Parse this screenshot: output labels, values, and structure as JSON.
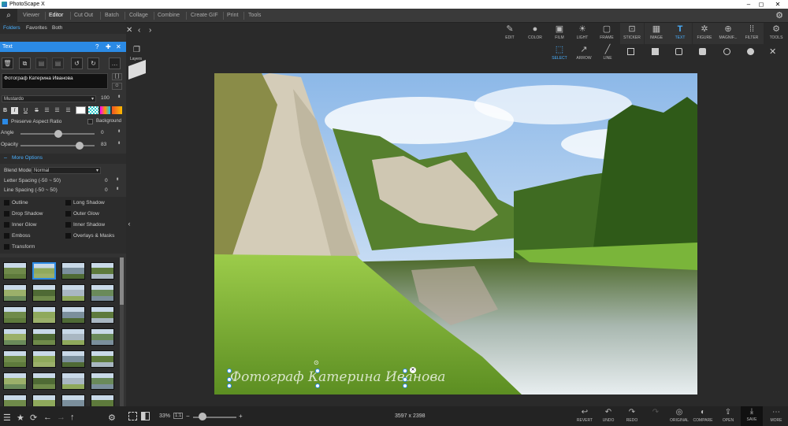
{
  "app": {
    "title": "PhotoScape X"
  },
  "menu": [
    "Viewer",
    "Editor",
    "Cut Out",
    "Batch",
    "Collage",
    "Combine",
    "Create GIF",
    "Print",
    "Tools"
  ],
  "left_tabs": [
    "Folders",
    "Favorites",
    "Both"
  ],
  "panel": {
    "title": "Text",
    "layers_label": "Layers",
    "text_value": "Фотограф Катерина Иванова",
    "font": "Mustardo",
    "font_size": "100",
    "preserve_label": "Preserve Aspect Ratio",
    "background_label": "Background",
    "angle_label": "Angle",
    "angle_value": "0",
    "opacity_label": "Opacity",
    "opacity_value": "83",
    "more_options": "More Options",
    "blend_label": "Blend Mode",
    "blend_value": "Normal",
    "letter_label": "Letter Spacing (-50 ~ 50)",
    "letter_value": "0",
    "line_label": "Line Spacing (-50 ~ 50)",
    "line_value": "0",
    "effects": {
      "outline": "Outline",
      "long_shadow": "Long Shadow",
      "drop_shadow": "Drop Shadow",
      "outer_glow": "Outer Glow",
      "inner_glow": "Inner Glow",
      "inner_shadow": "Inner Shadow",
      "emboss": "Emboss",
      "overlays": "Overlays & Masks",
      "transform": "Transform"
    },
    "format_buttons": [
      "B",
      "I",
      "U",
      "S"
    ]
  },
  "tools": {
    "top": [
      "EDIT",
      "COLOR",
      "FILM",
      "LIGHT",
      "FRAME",
      "STICKER",
      "IMAGE",
      "TEXT",
      "FIGURE",
      "MAGNIF...",
      "FILTER",
      "TOOLS"
    ],
    "sub": [
      "SELECT",
      "ARROW",
      "LINE"
    ]
  },
  "canvas": {
    "overlay_text": "Фотограф Катерина Иванова",
    "dimensions": "3597 x 2398"
  },
  "bottom": {
    "zoom": "33%",
    "fit": "1:1",
    "actions": [
      "REVERT",
      "UNDO",
      "REDO",
      "ORIGINAL",
      "COMPARE",
      "OPEN",
      "SAVE",
      "MORE"
    ]
  },
  "colors": {
    "accent": "#2b8ae5",
    "sky": "#b9d6f2",
    "grass": "#7cb43a",
    "water": "#5a7a3a",
    "cliff": "#d9d2c0"
  }
}
